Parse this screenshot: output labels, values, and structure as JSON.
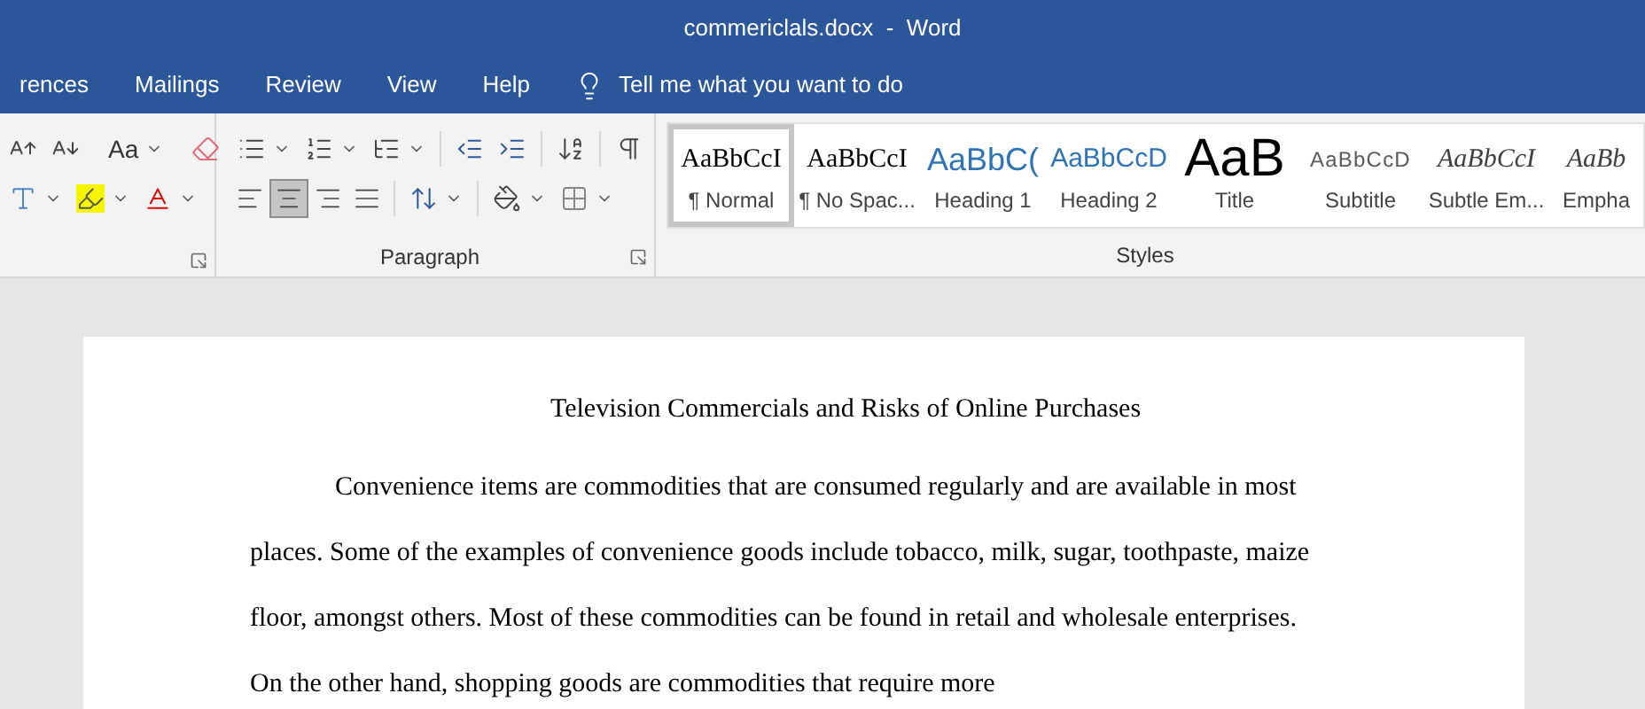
{
  "window": {
    "title": "commericlals.docx  -  Word"
  },
  "tabs": [
    {
      "label": "rences",
      "selected": false
    },
    {
      "label": "Mailings",
      "selected": false
    },
    {
      "label": "Review",
      "selected": false
    },
    {
      "label": "View",
      "selected": false
    },
    {
      "label": "Help",
      "selected": false
    }
  ],
  "tell_me": {
    "placeholder": "Tell me what you want to do"
  },
  "font_group": {
    "change_case": "Aa"
  },
  "paragraph_group": {
    "label": "Paragraph",
    "alignments": [
      {
        "kind": "left",
        "selected": false
      },
      {
        "kind": "center",
        "selected": true
      },
      {
        "kind": "right",
        "selected": false
      },
      {
        "kind": "justify",
        "selected": false
      }
    ]
  },
  "styles_group": {
    "label": "Styles",
    "items": [
      {
        "preview": "AaBbCcI",
        "label": "¶ Normal",
        "kind": "normal",
        "selected": true
      },
      {
        "preview": "AaBbCcI",
        "label": "¶ No Spac...",
        "kind": "normal",
        "selected": false
      },
      {
        "preview": "AaBbC(",
        "label": "Heading 1",
        "kind": "heading1",
        "selected": false
      },
      {
        "preview": "AaBbCcD",
        "label": "Heading 2",
        "kind": "heading2",
        "selected": false
      },
      {
        "preview": "AaB",
        "label": "Title",
        "kind": "title",
        "selected": false
      },
      {
        "preview": "AaBbCcD",
        "label": "Subtitle",
        "kind": "subtitle",
        "selected": false
      },
      {
        "preview": "AaBbCcI",
        "label": "Subtle Em...",
        "kind": "emphasis",
        "selected": false
      },
      {
        "preview": "AaBb",
        "label": "Empha",
        "kind": "emphasis",
        "selected": false
      }
    ]
  },
  "document": {
    "title": "Television Commercials and Risks of Online Purchases",
    "paragraph": "Convenience items are commodities that are consumed regularly and are available in most places. Some of the examples of convenience goods include tobacco, milk, sugar, toothpaste, maize floor, amongst others. Most of these commodities can be found in retail and wholesale enterprises. On the other hand, shopping goods are commodities that require more"
  }
}
